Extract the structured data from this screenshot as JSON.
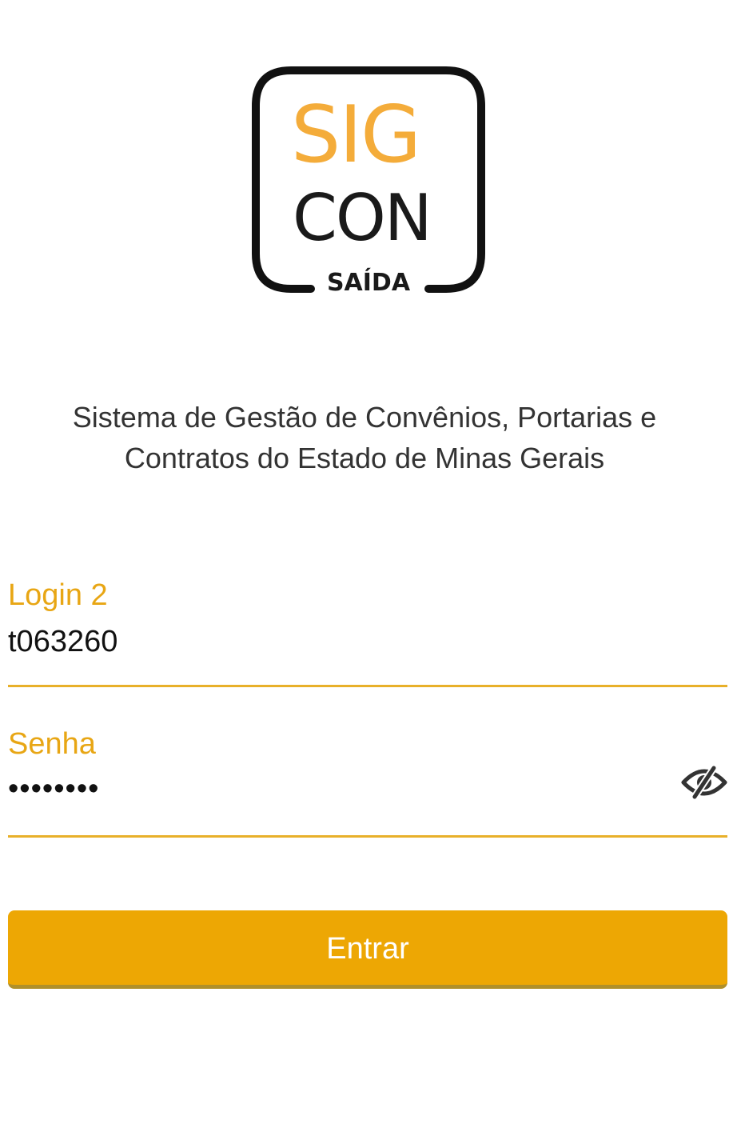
{
  "logo": {
    "line1": "SIG",
    "line2": "CON",
    "line3": "SAÍDA"
  },
  "subtitle": {
    "line1": "Sistema de Gestão de Convênios, Portarias e",
    "line2": "Contratos do Estado de Minas Gerais"
  },
  "login": {
    "label": "Login 2",
    "value": "t063260"
  },
  "password": {
    "label": "Senha",
    "value": "••••••••",
    "toggle_icon": "eye-off-icon"
  },
  "submit": {
    "label": "Entrar"
  },
  "colors": {
    "accent": "#eda704",
    "label": "#e8a614",
    "logo_orange": "#f4ac3a"
  }
}
